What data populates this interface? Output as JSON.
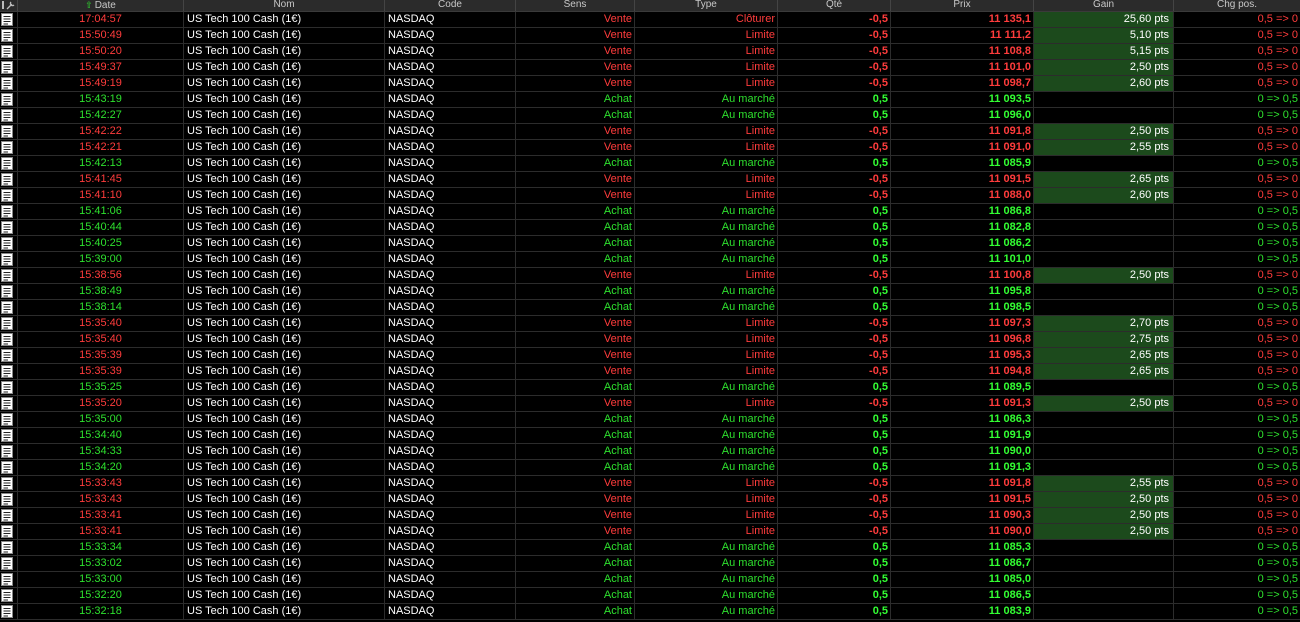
{
  "header": {
    "date": "Date",
    "nom": "Nom",
    "code": "Code",
    "sens": "Sens",
    "type": "Type",
    "qte": "Qté",
    "prix": "Prix",
    "gain": "Gain",
    "chg": "Chg pos."
  },
  "colors": {
    "sell": "#ff3c3c",
    "buy": "#2ee02e",
    "gain_bg": "#1c4a1c",
    "background": "#000000"
  },
  "rows": [
    {
      "date": "17:04:57",
      "nom": "US Tech 100 Cash (1€)",
      "code": "NASDAQ",
      "sens": "Vente",
      "type": "Clôturer",
      "qte": "-0,5",
      "prix": "11 135,1",
      "gain": "25,60 pts",
      "chg": "0,5 => 0"
    },
    {
      "date": "15:50:49",
      "nom": "US Tech 100 Cash (1€)",
      "code": "NASDAQ",
      "sens": "Vente",
      "type": "Limite",
      "qte": "-0,5",
      "prix": "11 111,2",
      "gain": "5,10 pts",
      "chg": "0,5 => 0"
    },
    {
      "date": "15:50:20",
      "nom": "US Tech 100 Cash (1€)",
      "code": "NASDAQ",
      "sens": "Vente",
      "type": "Limite",
      "qte": "-0,5",
      "prix": "11 108,8",
      "gain": "5,15 pts",
      "chg": "0,5 => 0"
    },
    {
      "date": "15:49:37",
      "nom": "US Tech 100 Cash (1€)",
      "code": "NASDAQ",
      "sens": "Vente",
      "type": "Limite",
      "qte": "-0,5",
      "prix": "11 101,0",
      "gain": "2,50 pts",
      "chg": "0,5 => 0"
    },
    {
      "date": "15:49:19",
      "nom": "US Tech 100 Cash (1€)",
      "code": "NASDAQ",
      "sens": "Vente",
      "type": "Limite",
      "qte": "-0,5",
      "prix": "11 098,7",
      "gain": "2,60 pts",
      "chg": "0,5 => 0"
    },
    {
      "date": "15:43:19",
      "nom": "US Tech 100 Cash (1€)",
      "code": "NASDAQ",
      "sens": "Achat",
      "type": "Au marché",
      "qte": "0,5",
      "prix": "11 093,5",
      "gain": "",
      "chg": "0 => 0,5"
    },
    {
      "date": "15:42:27",
      "nom": "US Tech 100 Cash (1€)",
      "code": "NASDAQ",
      "sens": "Achat",
      "type": "Au marché",
      "qte": "0,5",
      "prix": "11 096,0",
      "gain": "",
      "chg": "0 => 0,5"
    },
    {
      "date": "15:42:22",
      "nom": "US Tech 100 Cash (1€)",
      "code": "NASDAQ",
      "sens": "Vente",
      "type": "Limite",
      "qte": "-0,5",
      "prix": "11 091,8",
      "gain": "2,50 pts",
      "chg": "0,5 => 0"
    },
    {
      "date": "15:42:21",
      "nom": "US Tech 100 Cash (1€)",
      "code": "NASDAQ",
      "sens": "Vente",
      "type": "Limite",
      "qte": "-0,5",
      "prix": "11 091,0",
      "gain": "2,55 pts",
      "chg": "0,5 => 0"
    },
    {
      "date": "15:42:13",
      "nom": "US Tech 100 Cash (1€)",
      "code": "NASDAQ",
      "sens": "Achat",
      "type": "Au marché",
      "qte": "0,5",
      "prix": "11 085,9",
      "gain": "",
      "chg": "0 => 0,5"
    },
    {
      "date": "15:41:45",
      "nom": "US Tech 100 Cash (1€)",
      "code": "NASDAQ",
      "sens": "Vente",
      "type": "Limite",
      "qte": "-0,5",
      "prix": "11 091,5",
      "gain": "2,65 pts",
      "chg": "0,5 => 0"
    },
    {
      "date": "15:41:10",
      "nom": "US Tech 100 Cash (1€)",
      "code": "NASDAQ",
      "sens": "Vente",
      "type": "Limite",
      "qte": "-0,5",
      "prix": "11 088,0",
      "gain": "2,60 pts",
      "chg": "0,5 => 0"
    },
    {
      "date": "15:41:06",
      "nom": "US Tech 100 Cash (1€)",
      "code": "NASDAQ",
      "sens": "Achat",
      "type": "Au marché",
      "qte": "0,5",
      "prix": "11 086,8",
      "gain": "",
      "chg": "0 => 0,5"
    },
    {
      "date": "15:40:44",
      "nom": "US Tech 100 Cash (1€)",
      "code": "NASDAQ",
      "sens": "Achat",
      "type": "Au marché",
      "qte": "0,5",
      "prix": "11 082,8",
      "gain": "",
      "chg": "0 => 0,5"
    },
    {
      "date": "15:40:25",
      "nom": "US Tech 100 Cash (1€)",
      "code": "NASDAQ",
      "sens": "Achat",
      "type": "Au marché",
      "qte": "0,5",
      "prix": "11 086,2",
      "gain": "",
      "chg": "0 => 0,5"
    },
    {
      "date": "15:39:00",
      "nom": "US Tech 100 Cash (1€)",
      "code": "NASDAQ",
      "sens": "Achat",
      "type": "Au marché",
      "qte": "0,5",
      "prix": "11 101,0",
      "gain": "",
      "chg": "0 => 0,5"
    },
    {
      "date": "15:38:56",
      "nom": "US Tech 100 Cash (1€)",
      "code": "NASDAQ",
      "sens": "Vente",
      "type": "Limite",
      "qte": "-0,5",
      "prix": "11 100,8",
      "gain": "2,50 pts",
      "chg": "0,5 => 0"
    },
    {
      "date": "15:38:49",
      "nom": "US Tech 100 Cash (1€)",
      "code": "NASDAQ",
      "sens": "Achat",
      "type": "Au marché",
      "qte": "0,5",
      "prix": "11 095,8",
      "gain": "",
      "chg": "0 => 0,5"
    },
    {
      "date": "15:38:14",
      "nom": "US Tech 100 Cash (1€)",
      "code": "NASDAQ",
      "sens": "Achat",
      "type": "Au marché",
      "qte": "0,5",
      "prix": "11 098,5",
      "gain": "",
      "chg": "0 => 0,5"
    },
    {
      "date": "15:35:40",
      "nom": "US Tech 100 Cash (1€)",
      "code": "NASDAQ",
      "sens": "Vente",
      "type": "Limite",
      "qte": "-0,5",
      "prix": "11 097,3",
      "gain": "2,70 pts",
      "chg": "0,5 => 0"
    },
    {
      "date": "15:35:40",
      "nom": "US Tech 100 Cash (1€)",
      "code": "NASDAQ",
      "sens": "Vente",
      "type": "Limite",
      "qte": "-0,5",
      "prix": "11 096,8",
      "gain": "2,75 pts",
      "chg": "0,5 => 0"
    },
    {
      "date": "15:35:39",
      "nom": "US Tech 100 Cash (1€)",
      "code": "NASDAQ",
      "sens": "Vente",
      "type": "Limite",
      "qte": "-0,5",
      "prix": "11 095,3",
      "gain": "2,65 pts",
      "chg": "0,5 => 0"
    },
    {
      "date": "15:35:39",
      "nom": "US Tech 100 Cash (1€)",
      "code": "NASDAQ",
      "sens": "Vente",
      "type": "Limite",
      "qte": "-0,5",
      "prix": "11 094,8",
      "gain": "2,65 pts",
      "chg": "0,5 => 0"
    },
    {
      "date": "15:35:25",
      "nom": "US Tech 100 Cash (1€)",
      "code": "NASDAQ",
      "sens": "Achat",
      "type": "Au marché",
      "qte": "0,5",
      "prix": "11 089,5",
      "gain": "",
      "chg": "0 => 0,5"
    },
    {
      "date": "15:35:20",
      "nom": "US Tech 100 Cash (1€)",
      "code": "NASDAQ",
      "sens": "Vente",
      "type": "Limite",
      "qte": "-0,5",
      "prix": "11 091,3",
      "gain": "2,50 pts",
      "chg": "0,5 => 0"
    },
    {
      "date": "15:35:00",
      "nom": "US Tech 100 Cash (1€)",
      "code": "NASDAQ",
      "sens": "Achat",
      "type": "Au marché",
      "qte": "0,5",
      "prix": "11 086,3",
      "gain": "",
      "chg": "0 => 0,5"
    },
    {
      "date": "15:34:40",
      "nom": "US Tech 100 Cash (1€)",
      "code": "NASDAQ",
      "sens": "Achat",
      "type": "Au marché",
      "qte": "0,5",
      "prix": "11 091,9",
      "gain": "",
      "chg": "0 => 0,5"
    },
    {
      "date": "15:34:33",
      "nom": "US Tech 100 Cash (1€)",
      "code": "NASDAQ",
      "sens": "Achat",
      "type": "Au marché",
      "qte": "0,5",
      "prix": "11 090,0",
      "gain": "",
      "chg": "0 => 0,5"
    },
    {
      "date": "15:34:20",
      "nom": "US Tech 100 Cash (1€)",
      "code": "NASDAQ",
      "sens": "Achat",
      "type": "Au marché",
      "qte": "0,5",
      "prix": "11 091,3",
      "gain": "",
      "chg": "0 => 0,5"
    },
    {
      "date": "15:33:43",
      "nom": "US Tech 100 Cash (1€)",
      "code": "NASDAQ",
      "sens": "Vente",
      "type": "Limite",
      "qte": "-0,5",
      "prix": "11 091,8",
      "gain": "2,55 pts",
      "chg": "0,5 => 0"
    },
    {
      "date": "15:33:43",
      "nom": "US Tech 100 Cash (1€)",
      "code": "NASDAQ",
      "sens": "Vente",
      "type": "Limite",
      "qte": "-0,5",
      "prix": "11 091,5",
      "gain": "2,50 pts",
      "chg": "0,5 => 0"
    },
    {
      "date": "15:33:41",
      "nom": "US Tech 100 Cash (1€)",
      "code": "NASDAQ",
      "sens": "Vente",
      "type": "Limite",
      "qte": "-0,5",
      "prix": "11 090,3",
      "gain": "2,50 pts",
      "chg": "0,5 => 0"
    },
    {
      "date": "15:33:41",
      "nom": "US Tech 100 Cash (1€)",
      "code": "NASDAQ",
      "sens": "Vente",
      "type": "Limite",
      "qte": "-0,5",
      "prix": "11 090,0",
      "gain": "2,50 pts",
      "chg": "0,5 => 0"
    },
    {
      "date": "15:33:34",
      "nom": "US Tech 100 Cash (1€)",
      "code": "NASDAQ",
      "sens": "Achat",
      "type": "Au marché",
      "qte": "0,5",
      "prix": "11 085,3",
      "gain": "",
      "chg": "0 => 0,5"
    },
    {
      "date": "15:33:02",
      "nom": "US Tech 100 Cash (1€)",
      "code": "NASDAQ",
      "sens": "Achat",
      "type": "Au marché",
      "qte": "0,5",
      "prix": "11 086,7",
      "gain": "",
      "chg": "0 => 0,5"
    },
    {
      "date": "15:33:00",
      "nom": "US Tech 100 Cash (1€)",
      "code": "NASDAQ",
      "sens": "Achat",
      "type": "Au marché",
      "qte": "0,5",
      "prix": "11 085,0",
      "gain": "",
      "chg": "0 => 0,5"
    },
    {
      "date": "15:32:20",
      "nom": "US Tech 100 Cash (1€)",
      "code": "NASDAQ",
      "sens": "Achat",
      "type": "Au marché",
      "qte": "0,5",
      "prix": "11 086,5",
      "gain": "",
      "chg": "0 => 0,5"
    },
    {
      "date": "15:32:18",
      "nom": "US Tech 100 Cash (1€)",
      "code": "NASDAQ",
      "sens": "Achat",
      "type": "Au marché",
      "qte": "0,5",
      "prix": "11 083,9",
      "gain": "",
      "chg": "0 => 0,5"
    }
  ]
}
